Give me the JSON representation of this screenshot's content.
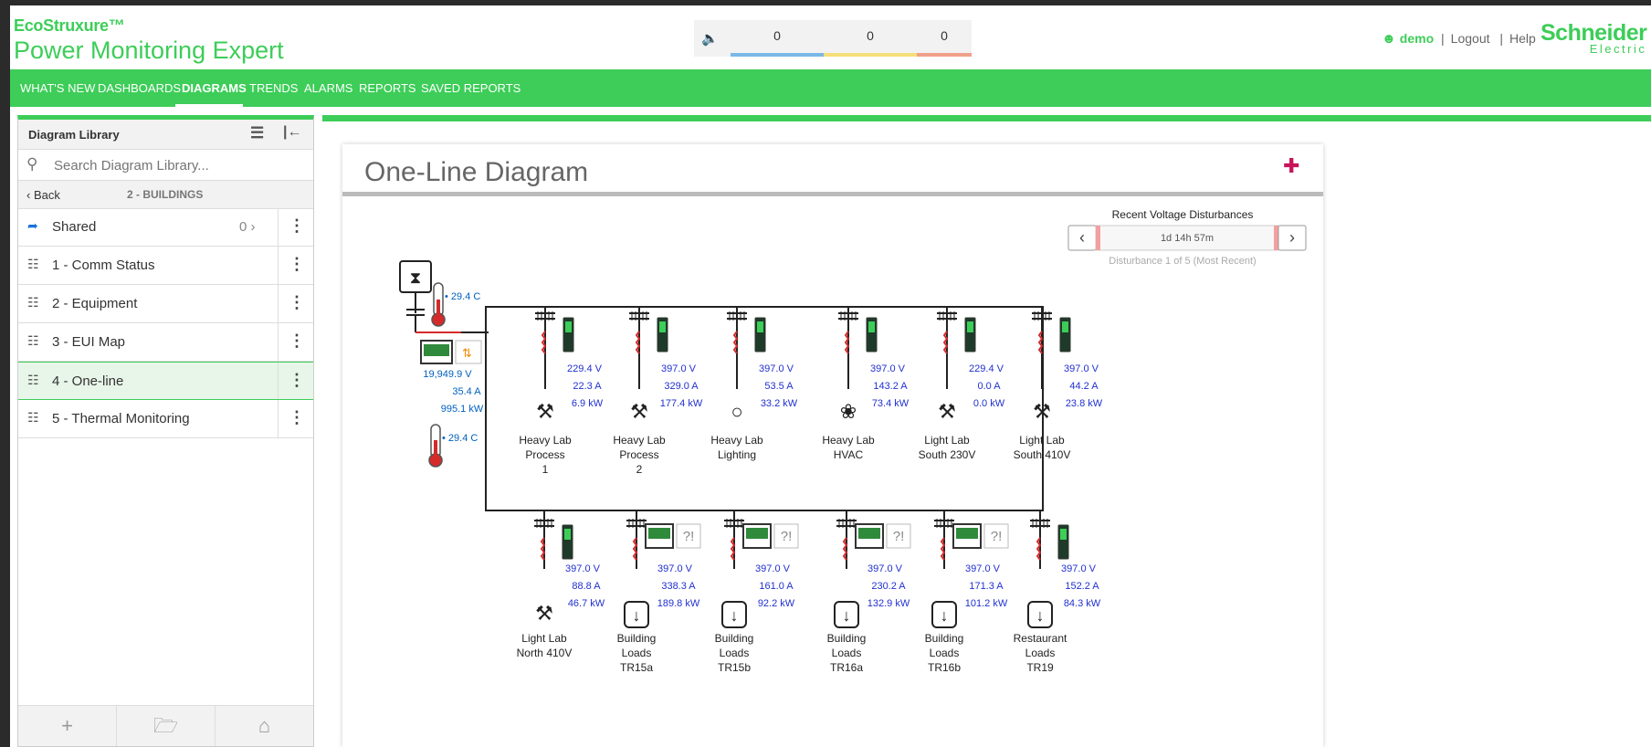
{
  "header": {
    "brand_line1": "EcoStruxure™",
    "brand_line2": "Power Monitoring Expert",
    "alarm_counts": [
      "0",
      "0",
      "0"
    ],
    "alarm_colors": [
      "#7ab8e8",
      "#f5df7a",
      "#f0a08a"
    ],
    "user_name": "demo",
    "logout_label": "Logout",
    "help_label": "Help",
    "logo_line1": "Schneider",
    "logo_line2": "Electric"
  },
  "nav": {
    "items": [
      "WHAT'S NEW",
      "DASHBOARDS",
      "DIAGRAMS",
      "TRENDS",
      "ALARMS",
      "REPORTS",
      "SAVED REPORTS"
    ],
    "active": "DIAGRAMS"
  },
  "library": {
    "title": "Diagram Library",
    "search_placeholder": "Search Diagram Library...",
    "back_label": "Back",
    "crumb": "2 - BUILDINGS",
    "items": [
      {
        "label": "Shared",
        "count": "0",
        "icon": "share-icon"
      },
      {
        "label": "1 - Comm Status",
        "icon": "hierarchy-icon"
      },
      {
        "label": "2 - Equipment",
        "icon": "hierarchy-icon"
      },
      {
        "label": "3 - EUI Map",
        "icon": "hierarchy-icon"
      },
      {
        "label": "4 - One-line",
        "icon": "hierarchy-icon",
        "selected": true
      },
      {
        "label": "5 - Thermal Monitoring",
        "icon": "hierarchy-icon"
      }
    ]
  },
  "diagram": {
    "title": "One-Line Diagram",
    "disturbance": {
      "title": "Recent Voltage Disturbances",
      "elapsed": "1d 14h 57m",
      "subtitle": "Disturbance 1 of 5 (Most Recent)"
    },
    "main_meter": {
      "temp_top": "29.4 C",
      "voltage": "19,949.9 V",
      "current": "35.4 A",
      "power": "995.1 kW",
      "temp_bottom": "29.4 C"
    },
    "top_feeders": [
      {
        "v": "229.4 V",
        "a": "22.3 A",
        "kw": "6.9 kW",
        "name": [
          "Heavy Lab",
          "Process",
          "1"
        ],
        "icon": "tools-icon"
      },
      {
        "v": "397.0 V",
        "a": "329.0 A",
        "kw": "177.4 kW",
        "name": [
          "Heavy Lab",
          "Process",
          "2"
        ],
        "icon": "tools-icon"
      },
      {
        "v": "397.0 V",
        "a": "53.5 A",
        "kw": "33.2 kW",
        "name": [
          "Heavy Lab",
          "Lighting"
        ],
        "icon": "bulb-icon"
      },
      {
        "v": "397.0 V",
        "a": "143.2 A",
        "kw": "73.4 kW",
        "name": [
          "Heavy Lab",
          "HVAC"
        ],
        "icon": "fan-icon"
      },
      {
        "v": "229.4 V",
        "a": "0.0 A",
        "kw": "0.0 kW",
        "name": [
          "Light Lab",
          "South 230V"
        ],
        "icon": "tools-icon"
      },
      {
        "v": "397.0 V",
        "a": "44.2 A",
        "kw": "23.8 kW",
        "name": [
          "Light Lab",
          "South 410V"
        ],
        "icon": "tools-icon"
      }
    ],
    "bottom_feeders": [
      {
        "v": "397.0 V",
        "a": "88.8 A",
        "kw": "46.7 kW",
        "name": [
          "Light Lab",
          "North 410V"
        ],
        "icon": "tools-icon"
      },
      {
        "v": "397.0 V",
        "a": "338.3 A",
        "kw": "189.8 kW",
        "name": [
          "Building",
          "Loads",
          "TR15a"
        ],
        "icon": "load-icon"
      },
      {
        "v": "397.0 V",
        "a": "161.0 A",
        "kw": "92.2 kW",
        "name": [
          "Building",
          "Loads",
          "TR15b"
        ],
        "icon": "load-icon"
      },
      {
        "v": "397.0 V",
        "a": "230.2 A",
        "kw": "132.9 kW",
        "name": [
          "Building",
          "Loads",
          "TR16a"
        ],
        "icon": "load-icon"
      },
      {
        "v": "397.0 V",
        "a": "171.3 A",
        "kw": "101.2 kW",
        "name": [
          "Building",
          "Loads",
          "TR16b"
        ],
        "icon": "load-icon"
      },
      {
        "v": "397.0 V",
        "a": "152.2 A",
        "kw": "84.3 kW",
        "name": [
          "Restaurant",
          "Loads",
          "TR19"
        ],
        "icon": "load-icon"
      }
    ]
  }
}
